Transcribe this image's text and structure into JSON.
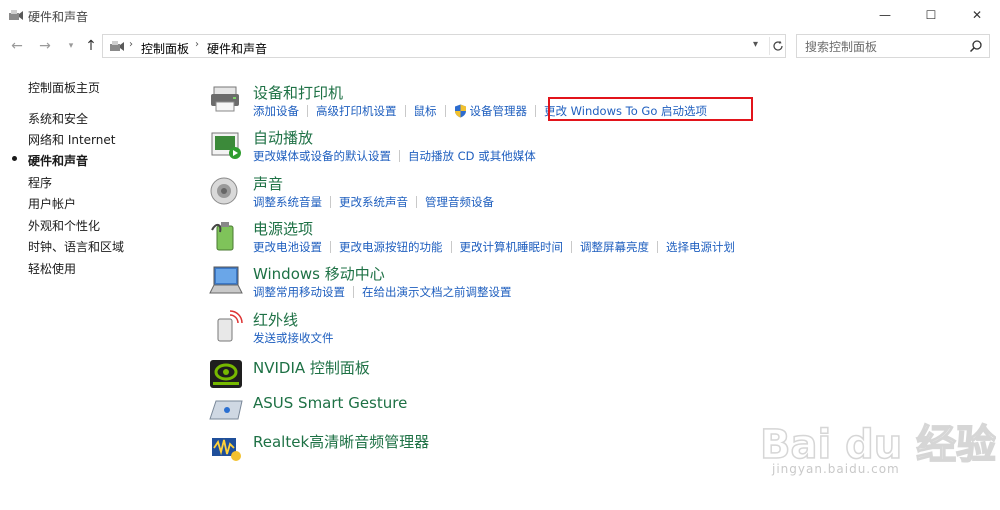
{
  "window": {
    "title": "硬件和声音",
    "buttons": {
      "minimize": "—",
      "maximize": "☐",
      "close": "✕"
    }
  },
  "nav": {
    "breadcrumb": [
      "控制面板",
      "硬件和声音"
    ],
    "search": {
      "placeholder": "搜索控制面板",
      "value": ""
    }
  },
  "sidebar": {
    "items": [
      {
        "label": "控制面板主页",
        "active": false
      },
      {
        "label": "系统和安全",
        "active": false
      },
      {
        "label": "网络和 Internet",
        "active": false
      },
      {
        "label": "硬件和声音",
        "active": true
      },
      {
        "label": "程序",
        "active": false
      },
      {
        "label": "用户帐户",
        "active": false
      },
      {
        "label": "外观和个性化",
        "active": false
      },
      {
        "label": "时钟、语言和区域",
        "active": false
      },
      {
        "label": "轻松使用",
        "active": false
      }
    ]
  },
  "categories": [
    {
      "title": "设备和打印机",
      "icon": "printer-icon",
      "links": [
        "添加设备",
        "高级打印机设置",
        "鼠标",
        "设备管理器",
        "更改 Windows To Go 启动选项"
      ]
    },
    {
      "title": "自动播放",
      "icon": "autoplay-icon",
      "links": [
        "更改媒体或设备的默认设置",
        "自动播放 CD 或其他媒体"
      ]
    },
    {
      "title": "声音",
      "icon": "speaker-icon",
      "links": [
        "调整系统音量",
        "更改系统声音",
        "管理音频设备"
      ]
    },
    {
      "title": "电源选项",
      "icon": "battery-icon",
      "links": [
        "更改电池设置",
        "更改电源按钮的功能",
        "更改计算机睡眠时间",
        "调整屏幕亮度",
        "选择电源计划"
      ]
    },
    {
      "title": "Windows 移动中心",
      "icon": "laptop-icon",
      "links": [
        "调整常用移动设置",
        "在给出演示文档之前调整设置"
      ]
    },
    {
      "title": "红外线",
      "icon": "infrared-icon",
      "links": [
        "发送或接收文件"
      ]
    },
    {
      "title": "NVIDIA 控制面板",
      "icon": "nvidia-icon",
      "links": []
    },
    {
      "title": "ASUS Smart Gesture",
      "icon": "touchpad-icon",
      "links": []
    },
    {
      "title": "Realtek高清晰音频管理器",
      "icon": "realtek-audio-icon",
      "links": []
    }
  ],
  "colors": {
    "link": "#1f5fbf",
    "title": "#1e7145",
    "highlight": "#e2141b"
  },
  "watermark": {
    "brand": "Bai du 经验",
    "url": "jingyan.baidu.com"
  }
}
